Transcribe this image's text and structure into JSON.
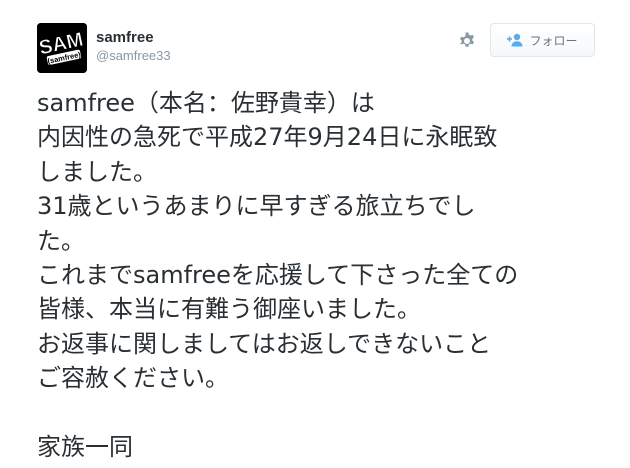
{
  "user": {
    "display_name": "samfree",
    "screen_name": "@samfree33",
    "avatar_text": "SAM",
    "avatar_subtext": "(samfree)"
  },
  "actions": {
    "settings_icon": "gear-icon",
    "follow_icon": "add-user-icon",
    "follow_label": "フォロー"
  },
  "tweet": {
    "lines": [
      "samfree（本名：佐野貴幸）は",
      "内因性の急死で平成27年9月24日に永眠致",
      "しました。",
      "31歳というあまりに早すぎる旅立ちでし",
      "た。",
      "これまでsamfreeを応援して下さった全ての",
      "皆様、本当に有難う御座いました。",
      "お返事に関しましてはお返しできないこと",
      "ご容赦ください。",
      "",
      "家族一同"
    ]
  },
  "colors": {
    "text": "#292f33",
    "secondary": "#8899a6",
    "button_border": "#e1e8ed",
    "button_text": "#66757f",
    "accent": "#55acee"
  }
}
